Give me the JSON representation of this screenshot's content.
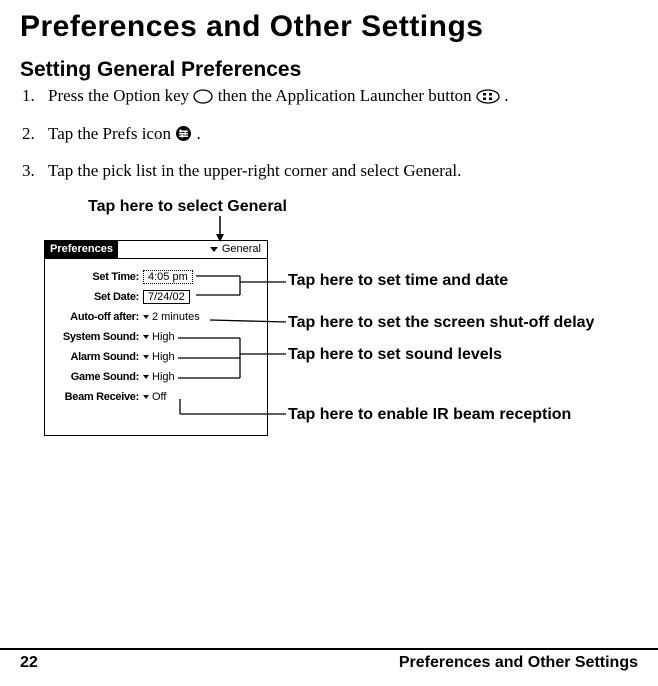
{
  "title": "Preferences and Other Settings",
  "subtitle": "Setting General Preferences",
  "steps": {
    "s1a": "Press the Option key ",
    "s1b": " then the Application Launcher button ",
    "s1c": ".",
    "s2a": "Tap the Prefs icon ",
    "s2b": ".",
    "s3": "Tap the pick list in the upper-right corner and select General."
  },
  "hints": {
    "top": "Tap here to select General",
    "time": "Tap here to set time and date",
    "delay": "Tap here to set the screen shut-off delay",
    "sound": "Tap here to set sound levels",
    "beam": "Tap here to enable IR beam reception"
  },
  "mock": {
    "appTitle": "Preferences",
    "picklist": "General",
    "rows": {
      "setTimeLabel": "Set Time:",
      "setTimeVal": "4:05 pm",
      "setDateLabel": "Set Date:",
      "setDateVal": "7/24/02",
      "autoOffLabel": "Auto-off after:",
      "autoOffVal": "2 minutes",
      "sysSoundLabel": "System Sound:",
      "sysSoundVal": "High",
      "alarmSoundLabel": "Alarm Sound:",
      "alarmSoundVal": "High",
      "gameSoundLabel": "Game Sound:",
      "gameSoundVal": "High",
      "beamLabel": "Beam Receive:",
      "beamVal": "Off"
    }
  },
  "footer": {
    "pageNum": "22",
    "section": "Preferences and Other Settings"
  }
}
